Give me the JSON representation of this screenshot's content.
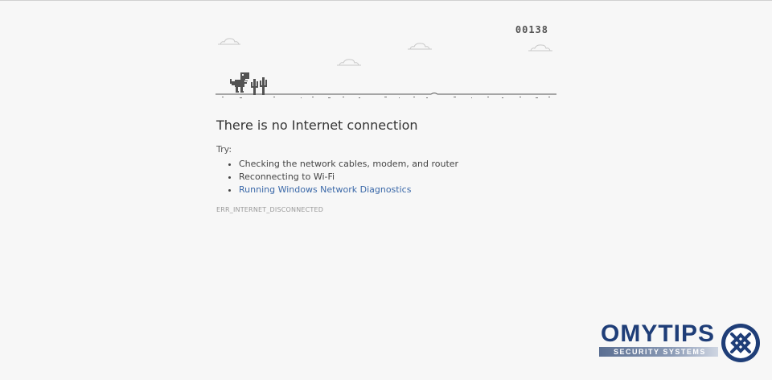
{
  "game": {
    "score": "00138",
    "icons": [
      "dinosaur-icon",
      "cactus-icon",
      "cloud-icon"
    ]
  },
  "error": {
    "title": "There is no Internet connection",
    "try_label": "Try:",
    "suggestions": [
      "Checking the network cables, modem, and router",
      "Reconnecting to Wi-Fi"
    ],
    "diagnostics_link": "Running Windows Network Diagnostics",
    "code": "ERR_INTERNET_DISCONNECTED"
  },
  "watermark": {
    "brand": "OMYTIPS",
    "tagline": "SECURITY SYSTEMS"
  },
  "colors": {
    "background": "#f7f7f7",
    "game_gray": "#535353",
    "link": "#3a68a8",
    "brand_blue": "#1f3e78"
  }
}
